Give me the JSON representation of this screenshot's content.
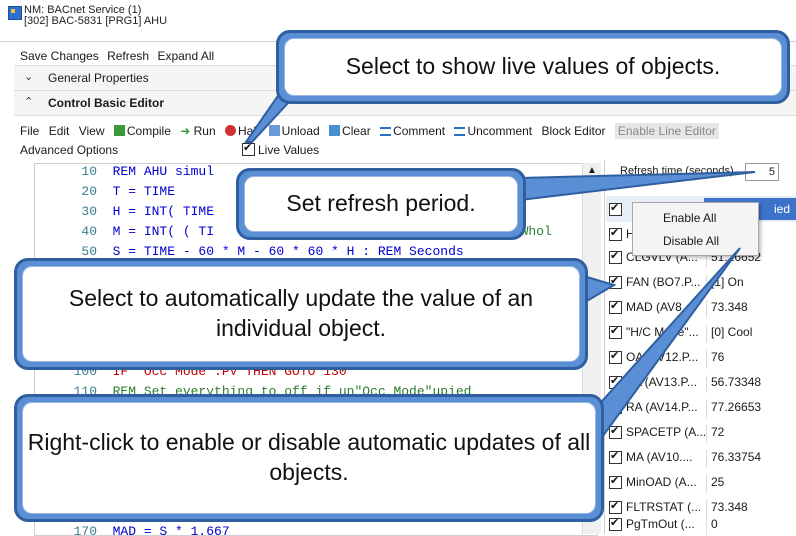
{
  "window": {
    "title_line1": "NM: BACnet Service (1)",
    "title_line2": "[302] BAC-5831 [PRG1] AHU"
  },
  "toolbar": {
    "save_changes": "Save Changes",
    "refresh": "Refresh",
    "expand_all": "Expand All"
  },
  "sections": {
    "general": "General Properties",
    "control": "Control Basic Editor"
  },
  "menu": {
    "file": "File",
    "edit": "Edit",
    "view": "View",
    "compile": "Compile",
    "run": "Run",
    "halt": "Halt",
    "unload": "Unload",
    "clear": "Clear",
    "comment": "Comment",
    "uncomment": "Uncomment",
    "block_editor": "Block Editor",
    "enable_line_editor": "Enable Line Editor",
    "advanced_options": "Advanced Options",
    "live_values": "Live Values"
  },
  "editor": {
    "lines": [
      {
        "num": "10",
        "text": "REM AHU simul"
      },
      {
        "num": "20",
        "text": "T = TIME"
      },
      {
        "num": "30",
        "text": "H = INT( TIME"
      },
      {
        "num": "40",
        "text": "M = INT( ( TI",
        "tail": "M Whol"
      },
      {
        "num": "50",
        "text": "S = TIME - 60 * M - 60 * 60 * H : REM Seconds"
      },
      {
        "num": "100",
        "text": "IF \"Occ Mode\".PV THEN GOTO 130"
      },
      {
        "num": "110",
        "text": "REM Set everything to off if un\"Occ Mode\"upied"
      },
      {
        "num": "170",
        "text": "MAD = S * 1.667"
      }
    ]
  },
  "refresh": {
    "label": "Refresh time (seconds)",
    "value": "5"
  },
  "header": {
    "right_label": "ied"
  },
  "context_menu": {
    "enable_all": "Enable All",
    "disable_all": "Disable All"
  },
  "objects": [
    {
      "name": "H",
      "value": ""
    },
    {
      "name": "CLGVLV (A...",
      "value": "51.26652"
    },
    {
      "name": "FAN (BO7.P...",
      "value": "[1] On"
    },
    {
      "name": "MAD (AV8....",
      "value": "73.348"
    },
    {
      "name": "\"H/C Mode\"...",
      "value": "[0] Cool"
    },
    {
      "name": "OA (AV12.P...",
      "value": "76"
    },
    {
      "name": "SA (AV13.P...",
      "value": "56.73348"
    },
    {
      "name": "RA (AV14.P...",
      "value": "77.26653"
    },
    {
      "name": "SPACETP (A...",
      "value": "72"
    },
    {
      "name": "MA (AV10....",
      "value": "76.33754"
    },
    {
      "name": "MinOAD (A...",
      "value": "25"
    },
    {
      "name": "FLTRSTAT (...",
      "value": "73.348"
    },
    {
      "name": "PgTmOut (...",
      "value": "0"
    }
  ],
  "callouts": {
    "live_values": "Select to show live values of objects.",
    "refresh_period": "Set refresh period.",
    "auto_update": "Select to automatically update the value of an individual object.",
    "right_click": "Right-click to enable or disable automatic updates of all objects."
  },
  "colors": {
    "callout_border": "#2f5f9f",
    "callout_fill": "#5a8fd6",
    "selection": "#3c73c9",
    "keyword": "#0000d0",
    "string": "#a31515"
  }
}
